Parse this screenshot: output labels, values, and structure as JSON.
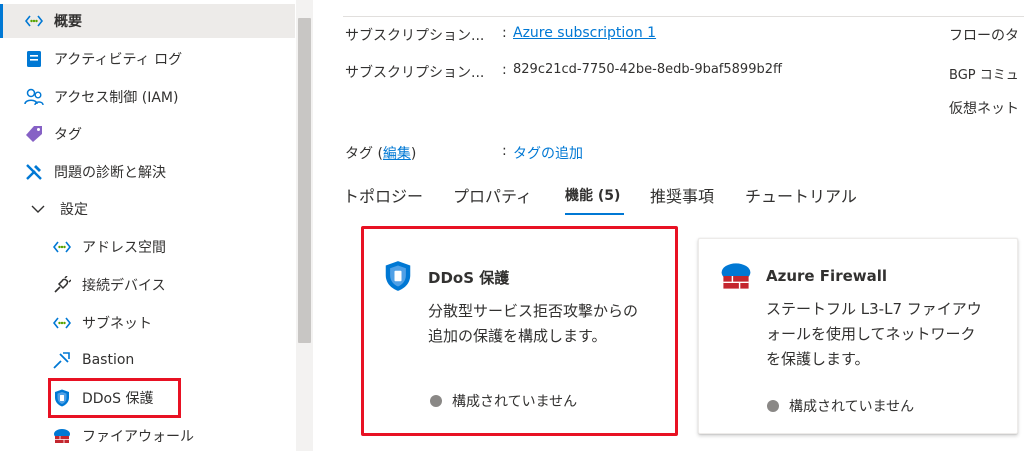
{
  "sidebar": {
    "items": [
      {
        "label": "概要",
        "icon": "network-brackets-icon"
      },
      {
        "label": "アクティビティ ログ",
        "icon": "activity-log-icon"
      },
      {
        "label": "アクセス制御 (IAM)",
        "icon": "people-icon"
      },
      {
        "label": "タグ",
        "icon": "tag-icon"
      },
      {
        "label": "問題の診断と解決",
        "icon": "wrench-icon"
      },
      {
        "label": "設定",
        "icon": "chevron-down-icon"
      },
      {
        "label": "アドレス空間",
        "icon": "network-brackets-icon"
      },
      {
        "label": "接続デバイス",
        "icon": "plug-icon"
      },
      {
        "label": "サブネット",
        "icon": "network-brackets-icon"
      },
      {
        "label": "Bastion",
        "icon": "bastion-icon"
      },
      {
        "label": "DDoS 保護",
        "icon": "shield-icon"
      },
      {
        "label": "ファイアウォール",
        "icon": "firewall-icon"
      }
    ]
  },
  "essentials": {
    "subscription_label": "サブスクリプション...",
    "subscription_value": "Azure subscription 1",
    "subscription_id_label": "サブスクリプション...",
    "subscription_id_value": "829c21cd-7750-42be-8edb-9baf5899b2ff",
    "right_label_1": "フローのタ",
    "right_label_2": "BGP コミュ",
    "right_label_3": "仮想ネット",
    "colon": ":",
    "tags_label": "タグ",
    "tags_edit_open": "(",
    "tags_edit": "編集",
    "tags_edit_close": ")",
    "tags_add": "タグの追加"
  },
  "tabs": [
    {
      "label": "トポロジー"
    },
    {
      "label": "プロパティ"
    },
    {
      "label": "機能 (5)"
    },
    {
      "label": "推奨事項"
    },
    {
      "label": "チュートリアル"
    }
  ],
  "cards": {
    "ddos": {
      "title": "DDoS 保護",
      "desc_line1": "分散型サービス拒否攻撃からの",
      "desc_line2": "追加の保護を構成します。",
      "status": "構成されていません",
      "icon": "shield-icon"
    },
    "firewall": {
      "title": "Azure Firewall",
      "desc_line1": "ステートフル L3-L7 ファイアウ",
      "desc_line2": "ォールを使用してネットワーク",
      "desc_line3": "を保護します。",
      "status": "構成されていません",
      "icon": "firewall-icon"
    }
  },
  "colors": {
    "accent": "#0078d4",
    "highlight": "#e81123",
    "status_dot": "#8a8886"
  }
}
